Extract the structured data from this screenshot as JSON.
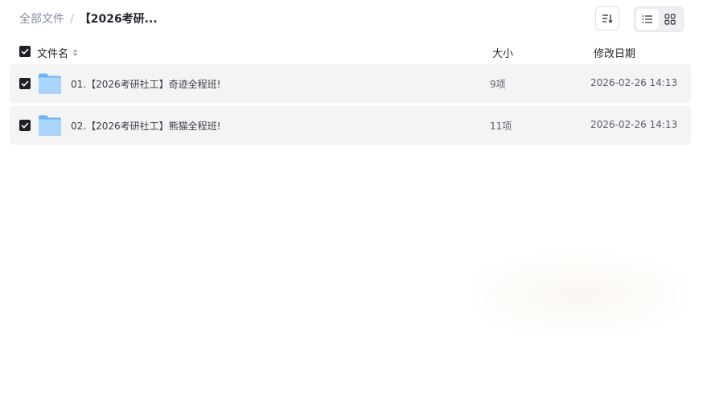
{
  "breadcrumb": {
    "root": "全部文件",
    "separator": "/",
    "current": "【2026考研..."
  },
  "toolbar": {
    "sort_icon": "sort-icon",
    "list_view_icon": "list-view-icon",
    "grid_view_icon": "grid-view-icon",
    "active_view": "list"
  },
  "header": {
    "name": "文件名",
    "size": "大小",
    "date": "修改日期",
    "all_checked": true
  },
  "files": [
    {
      "name": "01.【2026考研社工】奇迹全程班!",
      "size": "9项",
      "date": "2026-02-26 14:13",
      "checked": true,
      "icon": "folder-icon"
    },
    {
      "name": "02.【2026考研社工】熊猫全程班!",
      "size": "11项",
      "date": "2026-02-26 14:13",
      "checked": true,
      "icon": "folder-icon"
    }
  ],
  "colors": {
    "row_background": "#f4f4f5",
    "checkbox": "#1f2024",
    "folder_light": "#a9d4fb",
    "folder_dark": "#6fb4f1"
  }
}
